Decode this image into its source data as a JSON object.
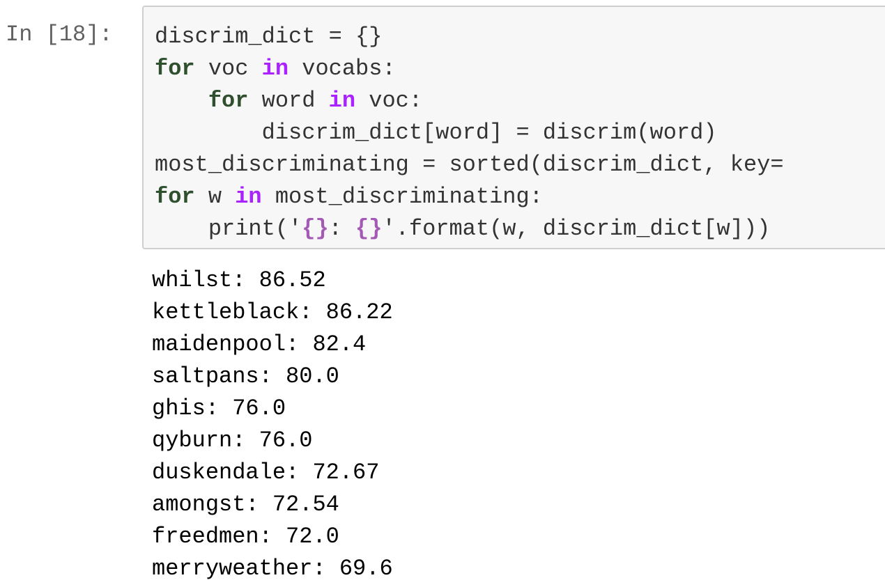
{
  "cell": {
    "prompt": "In [18]:",
    "code_lines": [
      [
        {
          "t": "discrim_dict = {}",
          "c": ""
        }
      ],
      [
        {
          "t": "for",
          "c": "kw-green"
        },
        {
          "t": " voc ",
          "c": ""
        },
        {
          "t": "in",
          "c": "op-in"
        },
        {
          "t": " vocabs:",
          "c": ""
        }
      ],
      [
        {
          "t": "    ",
          "c": ""
        },
        {
          "t": "for",
          "c": "kw-green"
        },
        {
          "t": " word ",
          "c": ""
        },
        {
          "t": "in",
          "c": "op-in"
        },
        {
          "t": " voc:",
          "c": ""
        }
      ],
      [
        {
          "t": "        discrim_dict[word] = discrim(word)",
          "c": ""
        }
      ],
      [
        {
          "t": "most_discriminating = sorted(discrim_dict, key=",
          "c": ""
        }
      ],
      [
        {
          "t": "for",
          "c": "kw-green"
        },
        {
          "t": " w ",
          "c": ""
        },
        {
          "t": "in",
          "c": "op-in"
        },
        {
          "t": " most_discriminating:",
          "c": ""
        }
      ],
      [
        {
          "t": "    print('",
          "c": ""
        },
        {
          "t": "{}",
          "c": "str-br"
        },
        {
          "t": ": ",
          "c": ""
        },
        {
          "t": "{}",
          "c": "str-br"
        },
        {
          "t": "'.format(w, discrim_dict[w]))",
          "c": ""
        }
      ]
    ],
    "output_lines": [
      "whilst: 86.52",
      "kettleblack: 86.22",
      "maidenpool: 82.4",
      "saltpans: 80.0",
      "ghis: 76.0",
      "qyburn: 76.0",
      "duskendale: 72.67",
      "amongst: 72.54",
      "freedmen: 72.0",
      "merryweather: 69.6"
    ]
  },
  "colors": {
    "prompt": "#616161",
    "input_background": "#f7f7f7",
    "input_border": "#cfcfcf",
    "keyword": "#2f4f2f",
    "operator_in": "#aa22ff",
    "string_brace": "#a45ab5"
  }
}
